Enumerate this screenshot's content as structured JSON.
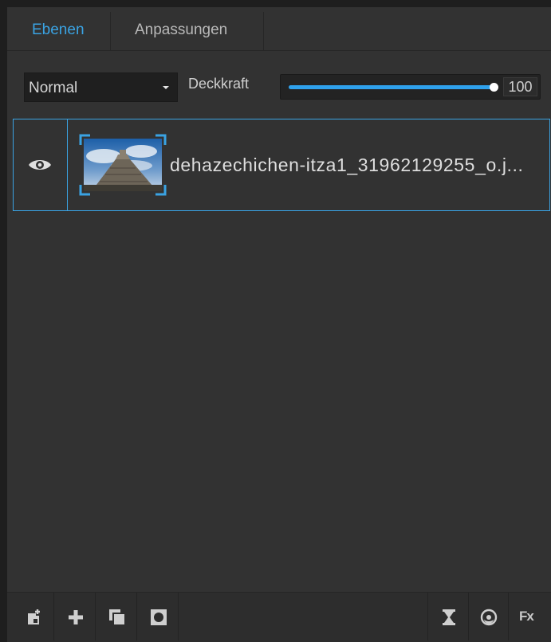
{
  "tabs": [
    {
      "label": "Ebenen",
      "active": true
    },
    {
      "label": "Anpassungen",
      "active": false
    }
  ],
  "blend_mode": {
    "selected": "Normal"
  },
  "opacity": {
    "label": "Deckkraft",
    "value": "100",
    "fraction": 1.0
  },
  "layers": [
    {
      "name": "dehazechichen-itza1_31962129255_o.j...",
      "visible": true,
      "selected": true,
      "thumbnail_icon": "photo-thumbnail"
    }
  ],
  "toolbar": {
    "left_buttons": [
      "new-layer-from-image-icon",
      "add-layer-icon",
      "duplicate-layer-icon",
      "layer-mask-icon"
    ],
    "right_buttons": [
      "hourglass-icon",
      "adjustment-circle-icon"
    ],
    "fx_label": "Fx"
  },
  "colors": {
    "accent": "#3aa3e3",
    "panel": "#323232",
    "background": "#1e1e1e"
  }
}
